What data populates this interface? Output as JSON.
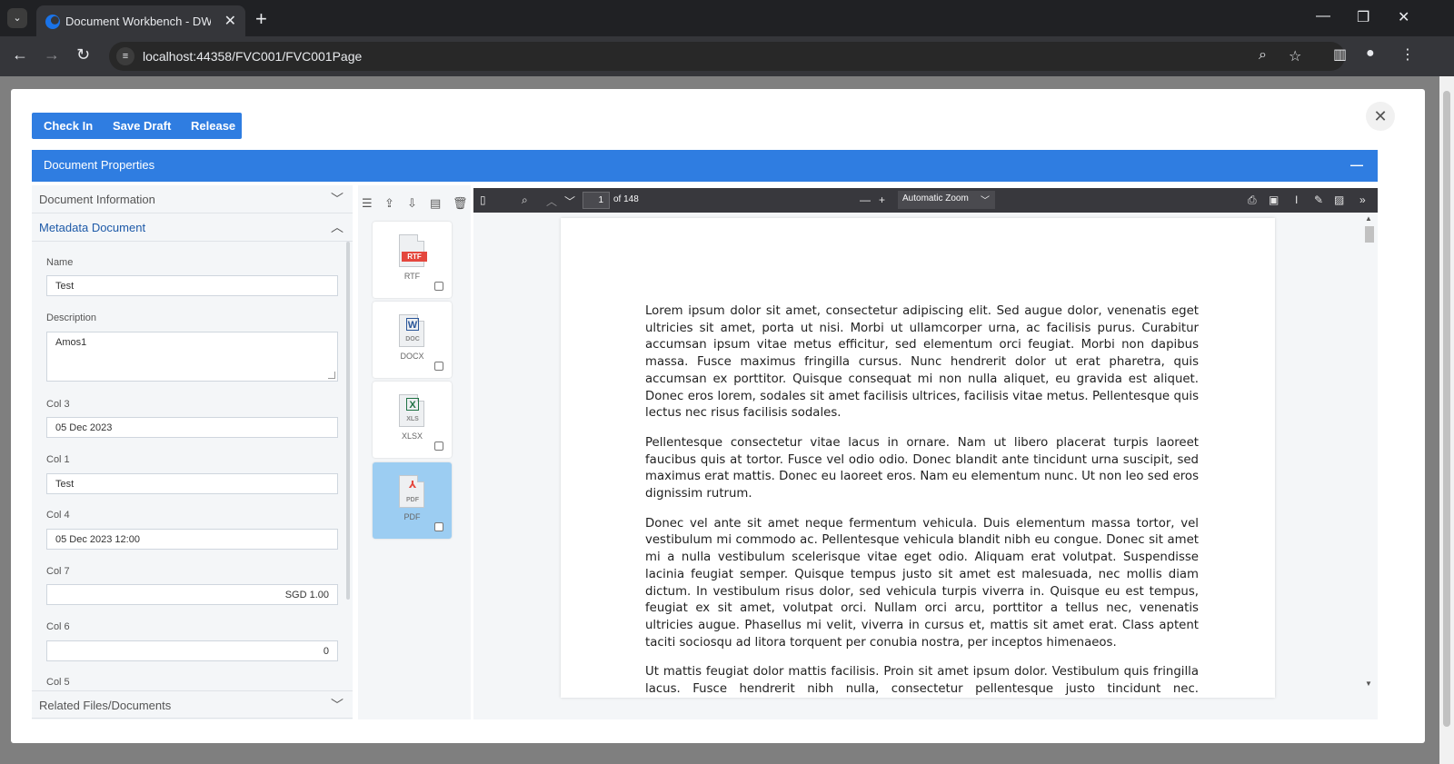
{
  "browser": {
    "tab_title": "Document Workbench - DWB...",
    "tab_close": "✕",
    "new_tab": "+",
    "url": "localhost:44358/FVC001/FVC001Page",
    "tab_list": "⌄",
    "minimize": "—",
    "restore": "❐",
    "close": "✕"
  },
  "modal": {
    "close": "✕",
    "actions": [
      {
        "label": "Check In"
      },
      {
        "label": "Save Draft"
      },
      {
        "label": "Release"
      }
    ],
    "properties_title": "Document Properties",
    "properties_collapse": "—"
  },
  "accordion": {
    "document_information": "Document Information",
    "metadata_document": "Metadata Document",
    "related_files": "Related Files/Documents"
  },
  "form": {
    "name_label": "Name",
    "name_value": "Test",
    "description_label": "Description",
    "description_value": "Amos1",
    "col3_label": "Col 3",
    "col3_value": "05 Dec 2023",
    "col1_label": "Col 1",
    "col1_value": "Test",
    "col4_label": "Col 4",
    "col4_value": "05 Dec 2023 12:00",
    "col7_label": "Col 7",
    "col7_value": "SGD 1.00",
    "col6_label": "Col 6",
    "col6_value": "0",
    "col5_label": "Col 5"
  },
  "files": [
    {
      "label": "RTF",
      "badge": "RTF",
      "badge_color": "#e4473d",
      "selected": false
    },
    {
      "label": "DOCX",
      "ext": "DOC",
      "glyph": "W",
      "glyph_color": "#2b579a",
      "selected": false
    },
    {
      "label": "XLSX",
      "ext": "XLS",
      "glyph": "X",
      "glyph_color": "#1f7244",
      "selected": false
    },
    {
      "label": "PDF",
      "ext": "PDF",
      "glyph": "⅄",
      "glyph_color": "#e4473d",
      "selected": true
    }
  ],
  "viewer": {
    "page_number": "1",
    "page_count": "of 148",
    "zoom": "Automatic Zoom",
    "paragraphs": [
      "Lorem ipsum dolor sit amet, consectetur adipiscing elit. Sed augue dolor, venenatis eget ultricies sit amet, porta ut nisi. Morbi ut ullamcorper urna, ac facilisis purus. Curabitur accumsan ipsum vitae metus efficitur, sed elementum orci feugiat. Morbi non dapibus massa. Fusce maximus fringilla cursus. Nunc hendrerit dolor ut erat pharetra, quis accumsan ex porttitor. Quisque consequat mi non nulla aliquet, eu gravida est aliquet. Donec eros lorem, sodales sit amet facilisis ultrices, facilisis vitae metus. Pellentesque quis lectus nec risus facilisis sodales.",
      "Pellentesque consectetur vitae lacus in ornare. Nam ut libero placerat turpis laoreet faucibus quis at tortor. Fusce vel odio odio. Donec blandit ante tincidunt urna suscipit, sed maximus erat mattis. Donec eu laoreet eros. Nam eu elementum nunc. Ut non leo sed eros dignissim rutrum.",
      "Donec vel ante sit amet neque fermentum vehicula. Duis elementum massa tortor, vel vestibulum mi commodo ac. Pellentesque vehicula blandit nibh eu congue. Donec sit amet mi a nulla vestibulum scelerisque vitae eget odio. Aliquam erat volutpat. Suspendisse lacinia feugiat semper. Quisque tempus justo sit amet est malesuada, nec mollis diam dictum. In vestibulum risus dolor, sed vehicula turpis viverra in. Quisque eu est tempus, feugiat ex sit amet, volutpat orci. Nullam orci arcu, porttitor a tellus nec, venenatis ultricies augue. Phasellus mi velit, viverra in cursus et, mattis sit amet erat. Class aptent taciti sociosqu ad litora torquent per conubia nostra, per inceptos himenaeos.",
      "Ut mattis feugiat dolor mattis facilisis. Proin sit amet ipsum dolor. Vestibulum quis fringilla lacus. Fusce hendrerit nibh nulla, consectetur pellentesque justo tincidunt nec. Suspendisse dictum lorem purus, non dictum nibh facilisis viverra. Aenean tempus velit non purus iaculis fermentum. Vestibulum ipsum est, imperdiet sed tincidunt vel, euismod eget nibh."
    ]
  },
  "colors": {
    "accent": "#2f7de1",
    "browser_dark": "#202124",
    "viewer_toolbar": "#38383d",
    "selected_card": "#9ccdf2"
  }
}
